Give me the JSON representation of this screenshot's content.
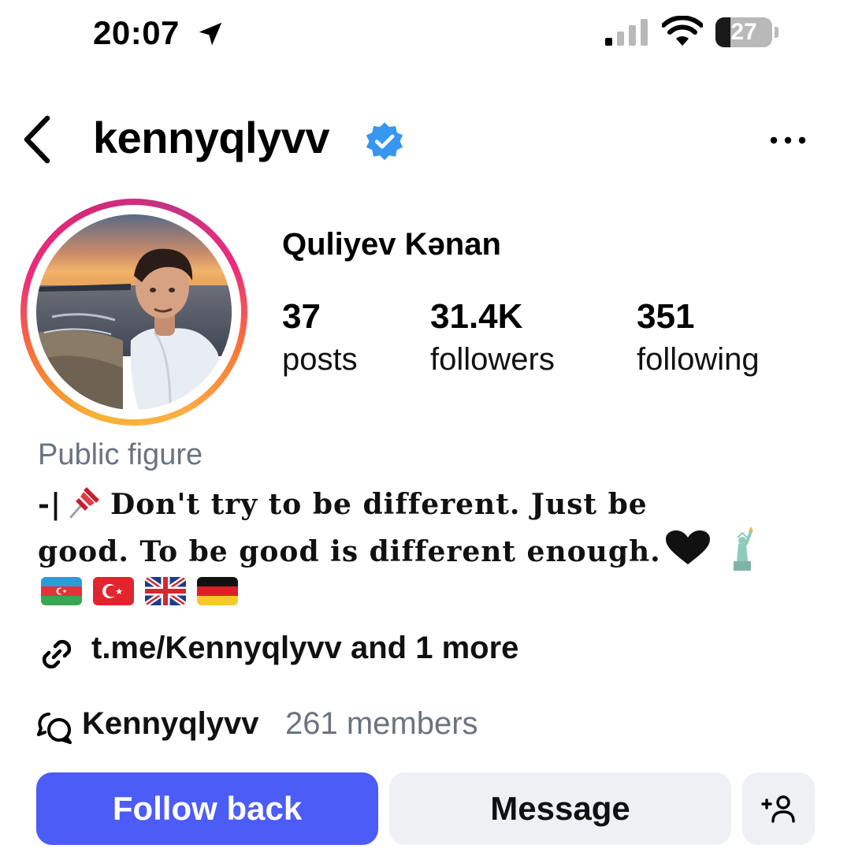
{
  "status_bar": {
    "time": "20:07",
    "battery_level": "27",
    "battery_fraction": 0.27,
    "signal_bars_active": 1,
    "signal_bars_total": 4
  },
  "header": {
    "username": "kennyqlyvv",
    "verified": true,
    "back_icon": "chevron-left-icon",
    "more_icon": "ellipsis-icon"
  },
  "profile": {
    "full_name": "Quliyev Kənan",
    "stats": {
      "posts": {
        "value": "37",
        "label": "posts"
      },
      "followers": {
        "value": "31.4K",
        "label": "followers"
      },
      "following": {
        "value": "351",
        "label": "following"
      }
    },
    "category": "Public figure",
    "bio": {
      "line1_prefix": "-|",
      "line1_text": "Don't try to be different. Just be",
      "line2_text": "good. To be good is different enough.",
      "emojis": [
        "pushpin",
        "black-heart",
        "statue-of-liberty"
      ],
      "flags": [
        "Azerbaijan",
        "Turkey",
        "United Kingdom",
        "Germany"
      ]
    },
    "link": {
      "text": "t.me/Kennyqlyvv and 1 more",
      "icon": "link-icon"
    },
    "channel": {
      "name": "Kennyqlyvv",
      "members": "261 members",
      "icon": "channel-chat-icon"
    }
  },
  "actions": {
    "follow_back": "Follow back",
    "message": "Message",
    "suggest_icon": "add-person-icon"
  },
  "colors": {
    "primary_button": "#4b5cf7",
    "secondary_button": "#eef0f3",
    "verified_badge": "#3797f0",
    "muted_text": "#6b7380"
  }
}
